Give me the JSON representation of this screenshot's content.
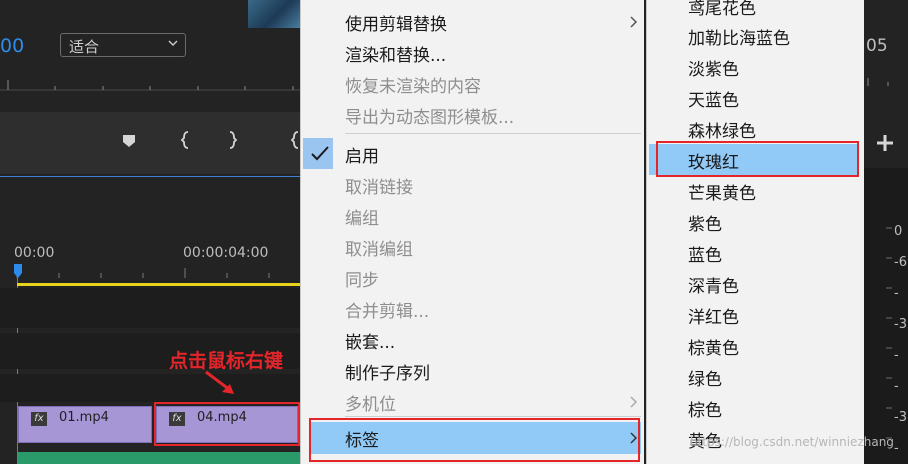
{
  "program": {
    "timecode_left": "00",
    "fit_select": "适合",
    "timecode_right_suffix": "05",
    "timeline_ruler": [
      "00:00",
      "00:00:04:00"
    ],
    "clips": [
      {
        "name": "01.mp4",
        "fx": "fx"
      },
      {
        "name": "04.mp4",
        "fx": "fx"
      }
    ],
    "annotation": "点击鼠标右键",
    "meter_labels": [
      "0",
      "-6",
      "-",
      "-3",
      "-",
      "-",
      "-3",
      "-",
      "-"
    ]
  },
  "context_menu": {
    "items": [
      {
        "label": "使用剪辑替换",
        "disabled": false,
        "submenu": true
      },
      {
        "label": "渲染和替换...",
        "disabled": false
      },
      {
        "label": "恢复未渲染的内容",
        "disabled": true
      },
      {
        "label": "导出为动态图形模板...",
        "disabled": true
      },
      {
        "label": "启用",
        "disabled": false,
        "checked": true
      },
      {
        "label": "取消链接",
        "disabled": true
      },
      {
        "label": "编组",
        "disabled": true
      },
      {
        "label": "取消编组",
        "disabled": true
      },
      {
        "label": "同步",
        "disabled": true
      },
      {
        "label": "合并剪辑...",
        "disabled": true
      },
      {
        "label": "嵌套...",
        "disabled": false
      },
      {
        "label": "制作子序列",
        "disabled": false
      },
      {
        "label": "多机位",
        "disabled": true,
        "submenu": true
      },
      {
        "label": "标签",
        "disabled": false,
        "submenu": true,
        "highlighted": true
      }
    ]
  },
  "label_submenu": {
    "items": [
      {
        "label": "鸢尾花色"
      },
      {
        "label": "加勒比海蓝色"
      },
      {
        "label": "淡紫色"
      },
      {
        "label": "天蓝色"
      },
      {
        "label": "森林绿色"
      },
      {
        "label": "玫瑰红",
        "selected": true
      },
      {
        "label": "芒果黄色"
      },
      {
        "label": "紫色"
      },
      {
        "label": "蓝色"
      },
      {
        "label": "深青色"
      },
      {
        "label": "洋红色"
      },
      {
        "label": "棕黄色"
      },
      {
        "label": "绿色"
      },
      {
        "label": "棕色"
      },
      {
        "label": "黄色"
      }
    ]
  },
  "watermark": "https://blog.csdn.net/winniezhang",
  "colors": {
    "highlight": "#91c9f7",
    "annotation_red": "#e4262b",
    "clip_purple": "#a696d6",
    "timecode_blue": "#2d8ceb"
  },
  "icons": [
    "marker-icon",
    "in-point-icon",
    "out-point-icon",
    "add-icon",
    "check-icon",
    "submenu-arrow-icon",
    "chevron-down-icon",
    "playhead-icon"
  ]
}
